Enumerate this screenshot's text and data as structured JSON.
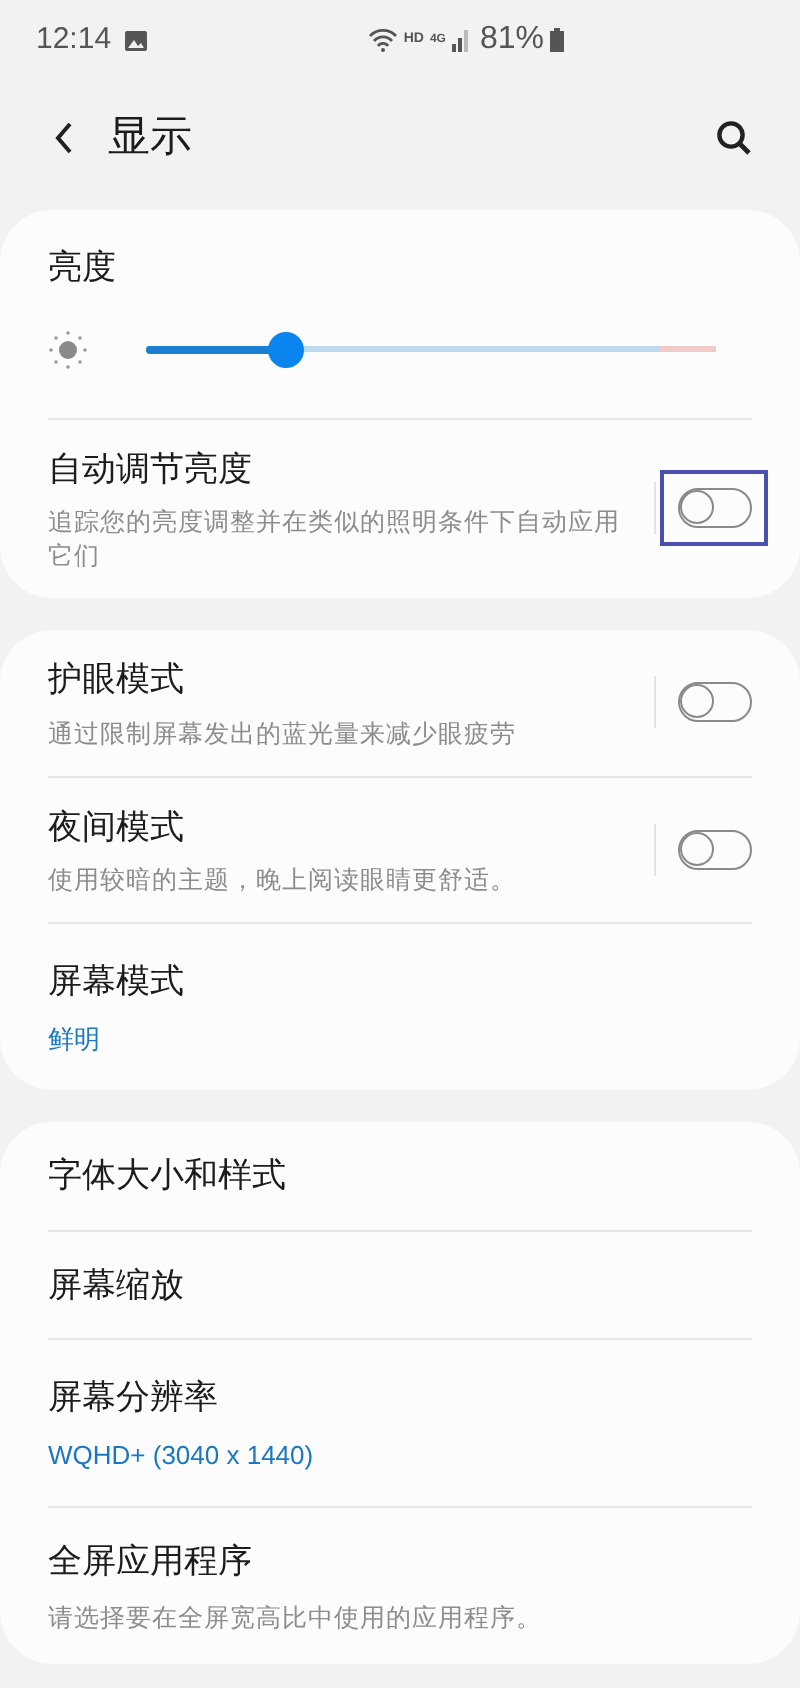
{
  "status_bar": {
    "time": "12:14",
    "network": "HD",
    "network_type": "4G",
    "battery": "81%"
  },
  "header": {
    "title": "显示"
  },
  "sections": [
    {
      "items": [
        {
          "kind": "slider",
          "title": "亮度",
          "level": 0.245
        },
        {
          "kind": "toggle",
          "title": "自动调节亮度",
          "description": "追踪您的亮度调整并在类似的照明条件下自动应用它们",
          "on": false,
          "highlighted": true
        }
      ]
    },
    {
      "items": [
        {
          "kind": "toggle",
          "title": "护眼模式",
          "description": "通过限制屏幕发出的蓝光量来减少眼疲劳",
          "on": false,
          "highlighted": false
        },
        {
          "kind": "toggle",
          "title": "夜间模式",
          "description": "使用较暗的主题，晚上阅读眼睛更舒适。",
          "on": false,
          "highlighted": false
        },
        {
          "kind": "value",
          "title": "屏幕模式",
          "value": "鲜明"
        }
      ]
    },
    {
      "items": [
        {
          "kind": "link",
          "title": "字体大小和样式"
        },
        {
          "kind": "link",
          "title": "屏幕缩放"
        },
        {
          "kind": "value",
          "title": "屏幕分辨率",
          "value": "WQHD+ (3040 x 1440)"
        },
        {
          "kind": "link",
          "title": "全屏应用程序",
          "description": "请选择要在全屏宽高比中使用的应用程序。"
        }
      ]
    }
  ]
}
